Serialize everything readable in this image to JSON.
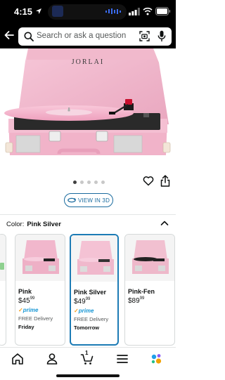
{
  "status_bar": {
    "time": "4:15",
    "location_icon": "location-arrow-icon",
    "signal_icon": "cell-signal-icon",
    "wifi_icon": "wifi-icon",
    "battery_icon": "battery-icon"
  },
  "search": {
    "placeholder": "Search or ask a question",
    "back_icon": "back-arrow-icon",
    "scan_icon": "camera-scan-icon",
    "mic_icon": "microphone-icon"
  },
  "product": {
    "brand_text": "JORLAI",
    "image_alt": "Pink suitcase record player with turntable"
  },
  "carousel": {
    "dot_count": 5,
    "active_index": 0
  },
  "actions": {
    "heart_icon": "heart-icon",
    "share_icon": "share-icon"
  },
  "view_3d": {
    "label": "VIEW IN 3D",
    "icon": "3d-view-icon"
  },
  "color": {
    "label": "Color:",
    "selected": "Pink Silver",
    "options": [
      {
        "name": "Pink",
        "price_whole": "$45",
        "price_fraction": "99",
        "prime": "prime",
        "delivery": "FREE Delivery",
        "day": "Friday",
        "selected": false
      },
      {
        "name": "Pink Silver",
        "price_whole": "$49",
        "price_fraction": "99",
        "prime": "prime",
        "delivery": "FREE Delivery",
        "day": "Tomorrow",
        "selected": true
      },
      {
        "name": "Pink-Fen",
        "price_whole": "$89",
        "price_fraction": "99",
        "prime": "",
        "delivery": "",
        "day": "",
        "selected": false
      }
    ]
  },
  "nav": {
    "cart_count": "1",
    "items": [
      "home-icon",
      "account-icon",
      "cart-icon",
      "menu-icon",
      "ai-assistant-icon"
    ]
  },
  "colors": {
    "pink": "#f2b7cd",
    "prime_blue": "#1a98d5",
    "selected_border": "#1c7bb5",
    "link": "#1a6b9e"
  }
}
